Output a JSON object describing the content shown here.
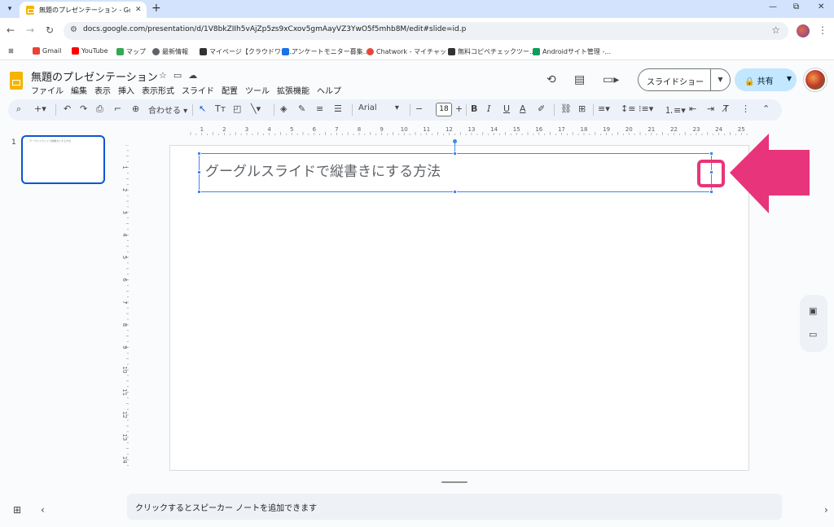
{
  "browser": {
    "tab_title": "無題のプレゼンテーション - Google",
    "new_tab": "+",
    "url": "docs.google.com/presentation/d/1V8bkZIIh5vAjZp5zs9xCxov5gmAayVZ3YwO5f5mhb8M/edit#slide=id.p"
  },
  "bookmarks": [
    {
      "label": "Gmail",
      "color": "#ea4335"
    },
    {
      "label": "YouTube",
      "color": "#ff0000"
    },
    {
      "label": "マップ",
      "color": "#34a853"
    },
    {
      "label": "最新情報",
      "color": "#5f6368"
    },
    {
      "label": "マイページ【クラウドワー...",
      "color": "#333333"
    },
    {
      "label": "アンケートモニター募集...",
      "color": "#1a73e8"
    },
    {
      "label": "Chatwork - マイチャット",
      "color": "#e8453c"
    },
    {
      "label": "無料コピペチェックツー...",
      "color": "#333333"
    },
    {
      "label": "Androidサイト管理 -...",
      "color": "#0f9d58"
    }
  ],
  "app": {
    "title": "無題のプレゼンテーション",
    "menu": [
      "ファイル",
      "編集",
      "表示",
      "挿入",
      "表示形式",
      "スライド",
      "配置",
      "ツール",
      "拡張機能",
      "ヘルプ"
    ],
    "slideshow_label": "スライドショー",
    "share_label": "共有"
  },
  "toolbar": {
    "zoom": "合わせる",
    "font": "Arial",
    "font_size": "18"
  },
  "filmstrip": {
    "slide_number": "1",
    "thumb_text": "グーグルスライドで縦書きにする方法"
  },
  "ruler": {
    "h_labels": [
      "1",
      "2",
      "3",
      "4",
      "5",
      "6",
      "7",
      "8",
      "9",
      "10",
      "11",
      "12",
      "13",
      "14",
      "15",
      "16",
      "17",
      "18",
      "19",
      "20",
      "21",
      "22",
      "23",
      "24",
      "25"
    ],
    "v_labels": [
      "1",
      "2",
      "3",
      "4",
      "5",
      "6",
      "7",
      "8",
      "9",
      "10",
      "11",
      "12",
      "13",
      "14"
    ]
  },
  "slide": {
    "title_text": "グーグルスライドで縦書きにする方法"
  },
  "notes": {
    "placeholder": "クリックするとスピーカー ノートを追加できます"
  },
  "colors": {
    "accent": "#4285f4",
    "annotation": "#e8347a"
  }
}
